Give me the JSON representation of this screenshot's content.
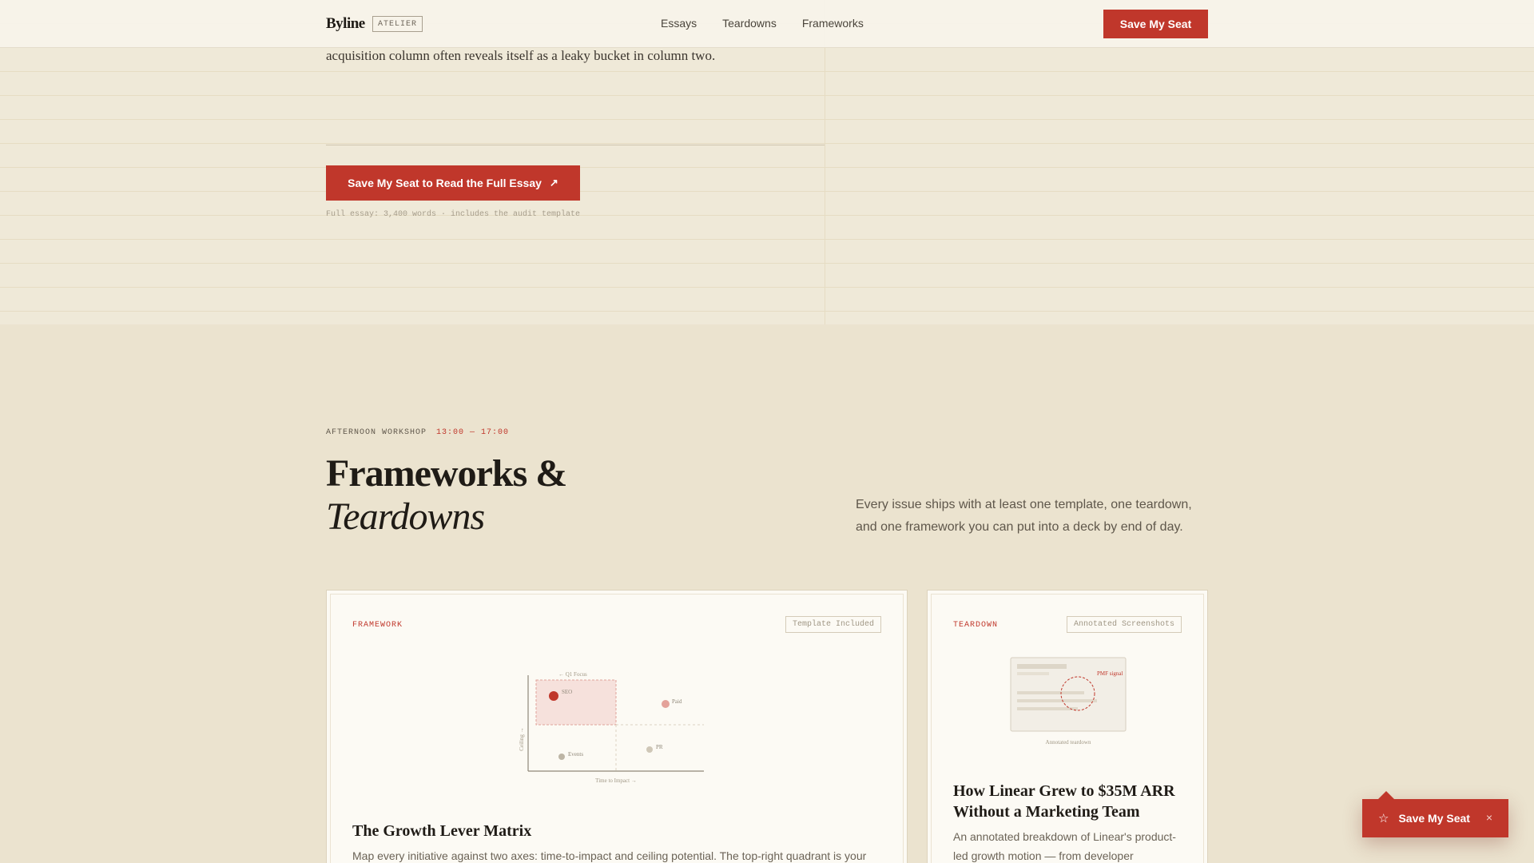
{
  "header": {
    "brand": "Byline",
    "badge": "ATELIER",
    "nav": [
      "Essays",
      "Teardowns",
      "Frameworks"
    ],
    "cta": "Save My Seat"
  },
  "essay": {
    "tail_text": "acquisition column often reveals itself as a leaky bucket in column two.",
    "read_button": "Save My Seat to Read the Full Essay",
    "arrow": "↗",
    "meta": "Full essay: 3,400 words · includes the audit template"
  },
  "workshop": {
    "eyebrow": "AFTERNOON WORKSHOP",
    "time": "13:00 — 17:00",
    "title_line1": "Frameworks &",
    "title_line2": "Teardowns",
    "description": "Every issue ships with at least one template, one teardown, and one framework you can put into a deck by end of day."
  },
  "cards": [
    {
      "kind": "FRAMEWORK",
      "tag": "Template Included",
      "title": "The Growth Lever Matrix",
      "body": "Map every initiative against two axes: time-to-impact and ceiling potential. The top-right quadrant is your",
      "figure": {
        "q1_label": "← Q1 Focus",
        "y_axis": "Ceiling →",
        "x_axis": "Time to Impact →",
        "points": [
          "SEO",
          "Paid",
          "PR",
          "Events"
        ]
      }
    },
    {
      "kind": "TEARDOWN",
      "tag": "Annotated Screenshots",
      "title": "How Linear Grew to $35M ARR Without a Marketing Team",
      "body": "An annotated breakdown of Linear's product-led growth motion — from developer",
      "figure": {
        "annotation": "PMF signal",
        "caption": "Annotated teardown"
      }
    }
  ],
  "float_cta": {
    "icon": "star-icon",
    "label": "Save My Seat",
    "close": "×"
  },
  "colors": {
    "accent": "#c0372b",
    "background": "#ebe3cf",
    "paper": "#fcfaf4"
  }
}
